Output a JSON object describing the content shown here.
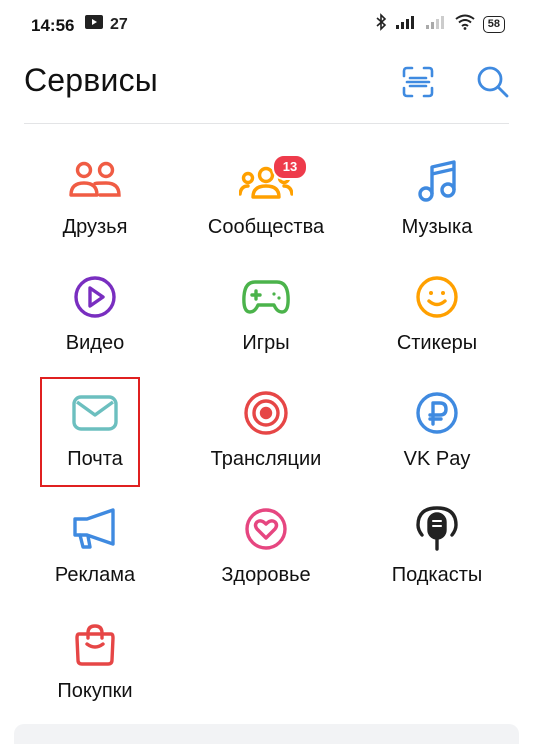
{
  "status_bar": {
    "time": "14:56",
    "notification_count": "27",
    "battery": "58"
  },
  "header": {
    "title": "Сервисы"
  },
  "services": [
    {
      "label": "Друзья",
      "icon": "friends-icon",
      "color": "#f05c44"
    },
    {
      "label": "Сообщества",
      "icon": "communities-icon",
      "color": "#ffa000",
      "badge": "13"
    },
    {
      "label": "Музыка",
      "icon": "music-note-icon",
      "color": "#3f8ae0"
    },
    {
      "label": "Видео",
      "icon": "video-play-icon",
      "color": "#792ec0"
    },
    {
      "label": "Игры",
      "icon": "gamepad-icon",
      "color": "#4bb34b"
    },
    {
      "label": "Стикеры",
      "icon": "smiley-icon",
      "color": "#ffa000"
    },
    {
      "label": "Почта",
      "icon": "mail-icon",
      "color": "#6cbfbf"
    },
    {
      "label": "Трансляции",
      "icon": "broadcast-icon",
      "color": "#e64646"
    },
    {
      "label": "VK Pay",
      "icon": "ruble-icon",
      "color": "#3f8ae0"
    },
    {
      "label": "Реклама",
      "icon": "megaphone-icon",
      "color": "#3f8ae0"
    },
    {
      "label": "Здоровье",
      "icon": "heart-icon",
      "color": "#e64680"
    },
    {
      "label": "Подкасты",
      "icon": "podcast-mic-icon",
      "color": "#222222"
    },
    {
      "label": "Покупки",
      "icon": "shopping-bag-icon",
      "color": "#e64646"
    }
  ]
}
